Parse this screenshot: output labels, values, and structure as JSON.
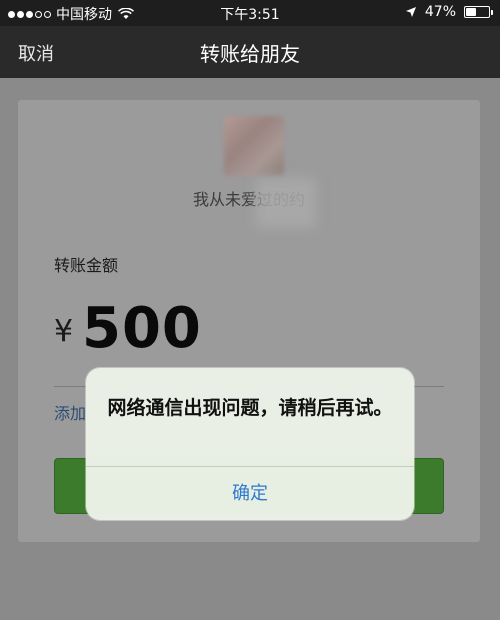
{
  "status_bar": {
    "carrier": "中国移动",
    "time": "下午3:51",
    "battery_text": "47%",
    "battery_level": 0.47
  },
  "nav": {
    "cancel_label": "取消",
    "title": "转账给朋友"
  },
  "transfer": {
    "recipient_name": "我从未爱过的约",
    "amount_label": "转账金额",
    "currency_symbol": "¥",
    "amount": "500",
    "add_note_label": "添加"
  },
  "alert": {
    "message": "网络通信出现问题，请稍后再试。",
    "confirm_label": "确定"
  },
  "colors": {
    "button_green": "#3c7a2c",
    "link_blue": "#2f7ad1",
    "nav_bg": "#2a2a2a"
  }
}
